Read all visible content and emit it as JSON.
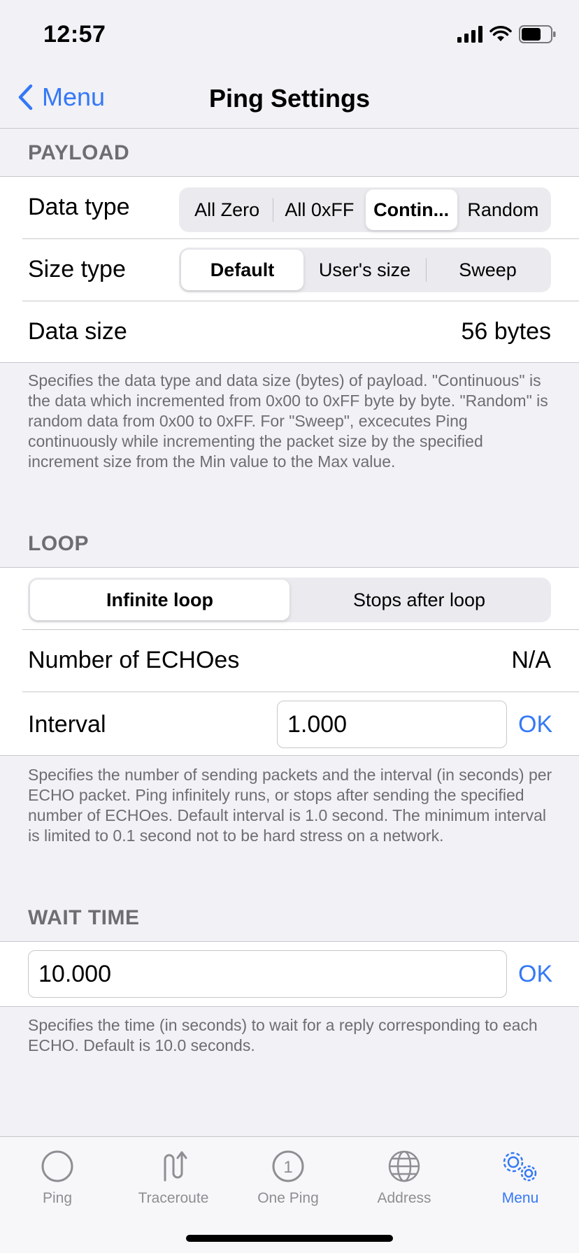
{
  "status_bar": {
    "time": "12:57"
  },
  "nav": {
    "back_label": "Menu",
    "title": "Ping Settings"
  },
  "payload": {
    "header": "PAYLOAD",
    "data_type_label": "Data type",
    "data_type_options": [
      "All Zero",
      "All 0xFF",
      "Contin...",
      "Random"
    ],
    "data_type_selected": "Contin...",
    "size_type_label": "Size type",
    "size_type_options": [
      "Default",
      "User's size",
      "Sweep"
    ],
    "size_type_selected": "Default",
    "data_size_label": "Data size",
    "data_size_value": "56 bytes",
    "footer": "Specifies the data type and data size (bytes) of payload. \"Continuous\" is the data which incremented from 0x00 to 0xFF byte by byte. \"Random\" is random data from 0x00 to 0xFF. For \"Sweep\", excecutes Ping continuously while incrementing the packet size by the specified increment size from the Min value to the Max value."
  },
  "loop": {
    "header": "LOOP",
    "options": [
      "Infinite loop",
      "Stops after loop"
    ],
    "selected": "Infinite loop",
    "echoes_label": "Number of ECHOes",
    "echoes_value": "N/A",
    "interval_label": "Interval",
    "interval_value": "1.000",
    "ok_label": "OK",
    "footer": "Specifies the number of sending packets and the interval (in seconds) per ECHO packet. Ping infinitely runs, or stops after sending the specified number of ECHOes. Default interval is 1.0 second. The minimum interval is limited to 0.1 second not to be hard stress on a network."
  },
  "wait_time": {
    "header": "WAIT TIME",
    "value": "10.000",
    "ok_label": "OK",
    "footer": "Specifies the time (in seconds) to wait for a reply corresponding to each ECHO. Default is 10.0 seconds."
  },
  "tabs": [
    {
      "label": "Ping",
      "icon": "circle-icon"
    },
    {
      "label": "Traceroute",
      "icon": "traceroute-icon"
    },
    {
      "label": "One Ping",
      "icon": "one-circle-icon"
    },
    {
      "label": "Address",
      "icon": "globe-icon"
    },
    {
      "label": "Menu",
      "icon": "gear-icon"
    }
  ],
  "active_tab": "Menu",
  "colors": {
    "accent": "#3478f6",
    "background": "#f1f1f6",
    "secondary_text": "#6d6d72"
  }
}
